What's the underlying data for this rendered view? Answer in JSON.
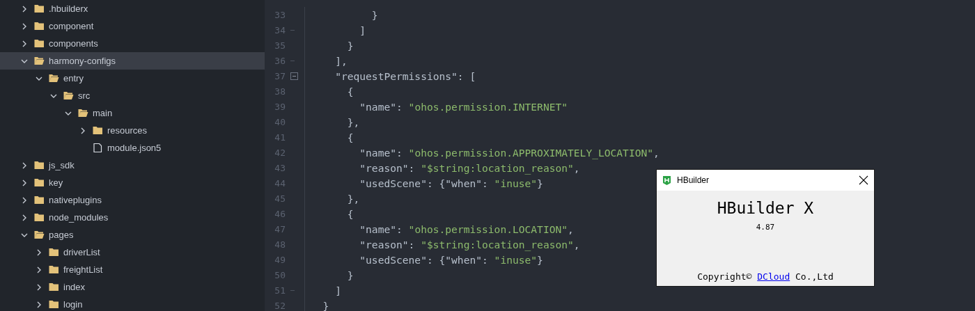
{
  "sidebar": {
    "tree": [
      {
        "name": ".hbuilderx",
        "kind": "folder",
        "expanded": false,
        "selected": false
      },
      {
        "name": "component",
        "kind": "folder",
        "expanded": false,
        "selected": false
      },
      {
        "name": "components",
        "kind": "folder",
        "expanded": false,
        "selected": false
      },
      {
        "name": "harmony-configs",
        "kind": "folder",
        "expanded": true,
        "selected": true,
        "children": [
          {
            "name": "entry",
            "kind": "folder",
            "expanded": true,
            "selected": false,
            "children": [
              {
                "name": "src",
                "kind": "folder",
                "expanded": true,
                "selected": false,
                "children": [
                  {
                    "name": "main",
                    "kind": "folder",
                    "expanded": true,
                    "selected": false,
                    "children": [
                      {
                        "name": "resources",
                        "kind": "folder",
                        "expanded": false,
                        "selected": false
                      },
                      {
                        "name": "module.json5",
                        "kind": "file",
                        "selected": false
                      }
                    ]
                  }
                ]
              }
            ]
          }
        ]
      },
      {
        "name": "js_sdk",
        "kind": "folder",
        "expanded": false,
        "selected": false
      },
      {
        "name": "key",
        "kind": "folder",
        "expanded": false,
        "selected": false
      },
      {
        "name": "nativeplugins",
        "kind": "folder",
        "expanded": false,
        "selected": false
      },
      {
        "name": "node_modules",
        "kind": "folder",
        "expanded": false,
        "selected": false
      },
      {
        "name": "pages",
        "kind": "folder",
        "expanded": true,
        "selected": false,
        "children": [
          {
            "name": "driverList",
            "kind": "folder",
            "expanded": false,
            "selected": false
          },
          {
            "name": "freightList",
            "kind": "folder",
            "expanded": false,
            "selected": false
          },
          {
            "name": "index",
            "kind": "folder",
            "expanded": false,
            "selected": false
          },
          {
            "name": "login",
            "kind": "folder",
            "expanded": false,
            "selected": false
          }
        ]
      }
    ]
  },
  "editor": {
    "lines": [
      {
        "number": "33",
        "kind": "plain",
        "tokens": [
          {
            "kind": "punct",
            "text": "          }"
          }
        ]
      },
      {
        "number": "34",
        "kind": "fold_end",
        "tokens": [
          {
            "kind": "punct",
            "text": "        ]"
          }
        ]
      },
      {
        "number": "35",
        "kind": "plain",
        "tokens": [
          {
            "kind": "punct",
            "text": "      }"
          }
        ]
      },
      {
        "number": "36",
        "kind": "fold_end",
        "tokens": [
          {
            "kind": "punct",
            "text": "    ],"
          }
        ]
      },
      {
        "number": "37",
        "kind": "fold_open",
        "tokens": [
          {
            "kind": "punct",
            "text": "    \"requestPermissions\": ["
          }
        ]
      },
      {
        "number": "38",
        "kind": "plain",
        "tokens": [
          {
            "kind": "punct",
            "text": "      {"
          }
        ]
      },
      {
        "number": "39",
        "kind": "plain",
        "tokens": [
          {
            "kind": "punct",
            "text": "        \"name\": "
          },
          {
            "kind": "string",
            "text": "\"ohos.permission.INTERNET\""
          }
        ]
      },
      {
        "number": "40",
        "kind": "plain",
        "tokens": [
          {
            "kind": "punct",
            "text": "      },"
          }
        ]
      },
      {
        "number": "41",
        "kind": "plain",
        "tokens": [
          {
            "kind": "punct",
            "text": "      {"
          }
        ]
      },
      {
        "number": "42",
        "kind": "plain",
        "tokens": [
          {
            "kind": "punct",
            "text": "        \"name\": "
          },
          {
            "kind": "string",
            "text": "\"ohos.permission.APPROXIMATELY_LOCATION\""
          },
          {
            "kind": "punct",
            "text": ","
          }
        ]
      },
      {
        "number": "43",
        "kind": "plain",
        "tokens": [
          {
            "kind": "punct",
            "text": "        \"reason\": "
          },
          {
            "kind": "string",
            "text": "\"$string:location_reason\""
          },
          {
            "kind": "punct",
            "text": ","
          }
        ]
      },
      {
        "number": "44",
        "kind": "plain",
        "tokens": [
          {
            "kind": "punct",
            "text": "        \"usedScene\": {\"when\": "
          },
          {
            "kind": "string",
            "text": "\"inuse\""
          },
          {
            "kind": "punct",
            "text": "}"
          }
        ]
      },
      {
        "number": "45",
        "kind": "plain",
        "tokens": [
          {
            "kind": "punct",
            "text": "      },"
          }
        ]
      },
      {
        "number": "46",
        "kind": "plain",
        "tokens": [
          {
            "kind": "punct",
            "text": "      {"
          }
        ]
      },
      {
        "number": "47",
        "kind": "plain",
        "tokens": [
          {
            "kind": "punct",
            "text": "        \"name\": "
          },
          {
            "kind": "string",
            "text": "\"ohos.permission.LOCATION\""
          },
          {
            "kind": "punct",
            "text": ","
          }
        ]
      },
      {
        "number": "48",
        "kind": "plain",
        "tokens": [
          {
            "kind": "punct",
            "text": "        \"reason\": "
          },
          {
            "kind": "string",
            "text": "\"$string:location_reason\""
          },
          {
            "kind": "punct",
            "text": ","
          }
        ]
      },
      {
        "number": "49",
        "kind": "plain",
        "tokens": [
          {
            "kind": "punct",
            "text": "        \"usedScene\": {\"when\": "
          },
          {
            "kind": "string",
            "text": "\"inuse\""
          },
          {
            "kind": "punct",
            "text": "}"
          }
        ]
      },
      {
        "number": "50",
        "kind": "plain",
        "tokens": [
          {
            "kind": "punct",
            "text": "      }"
          }
        ]
      },
      {
        "number": "51",
        "kind": "fold_end",
        "tokens": [
          {
            "kind": "punct",
            "text": "    ]"
          }
        ]
      },
      {
        "number": "52",
        "kind": "plain",
        "tokens": [
          {
            "kind": "punct",
            "text": "  }"
          }
        ]
      }
    ]
  },
  "about_dialog": {
    "title": "HBuilder",
    "product": "HBuilder X",
    "version": "4.87",
    "copyright": {
      "before": "Copyright© ",
      "link": "DCloud",
      "after": " Co.,Ltd"
    }
  }
}
